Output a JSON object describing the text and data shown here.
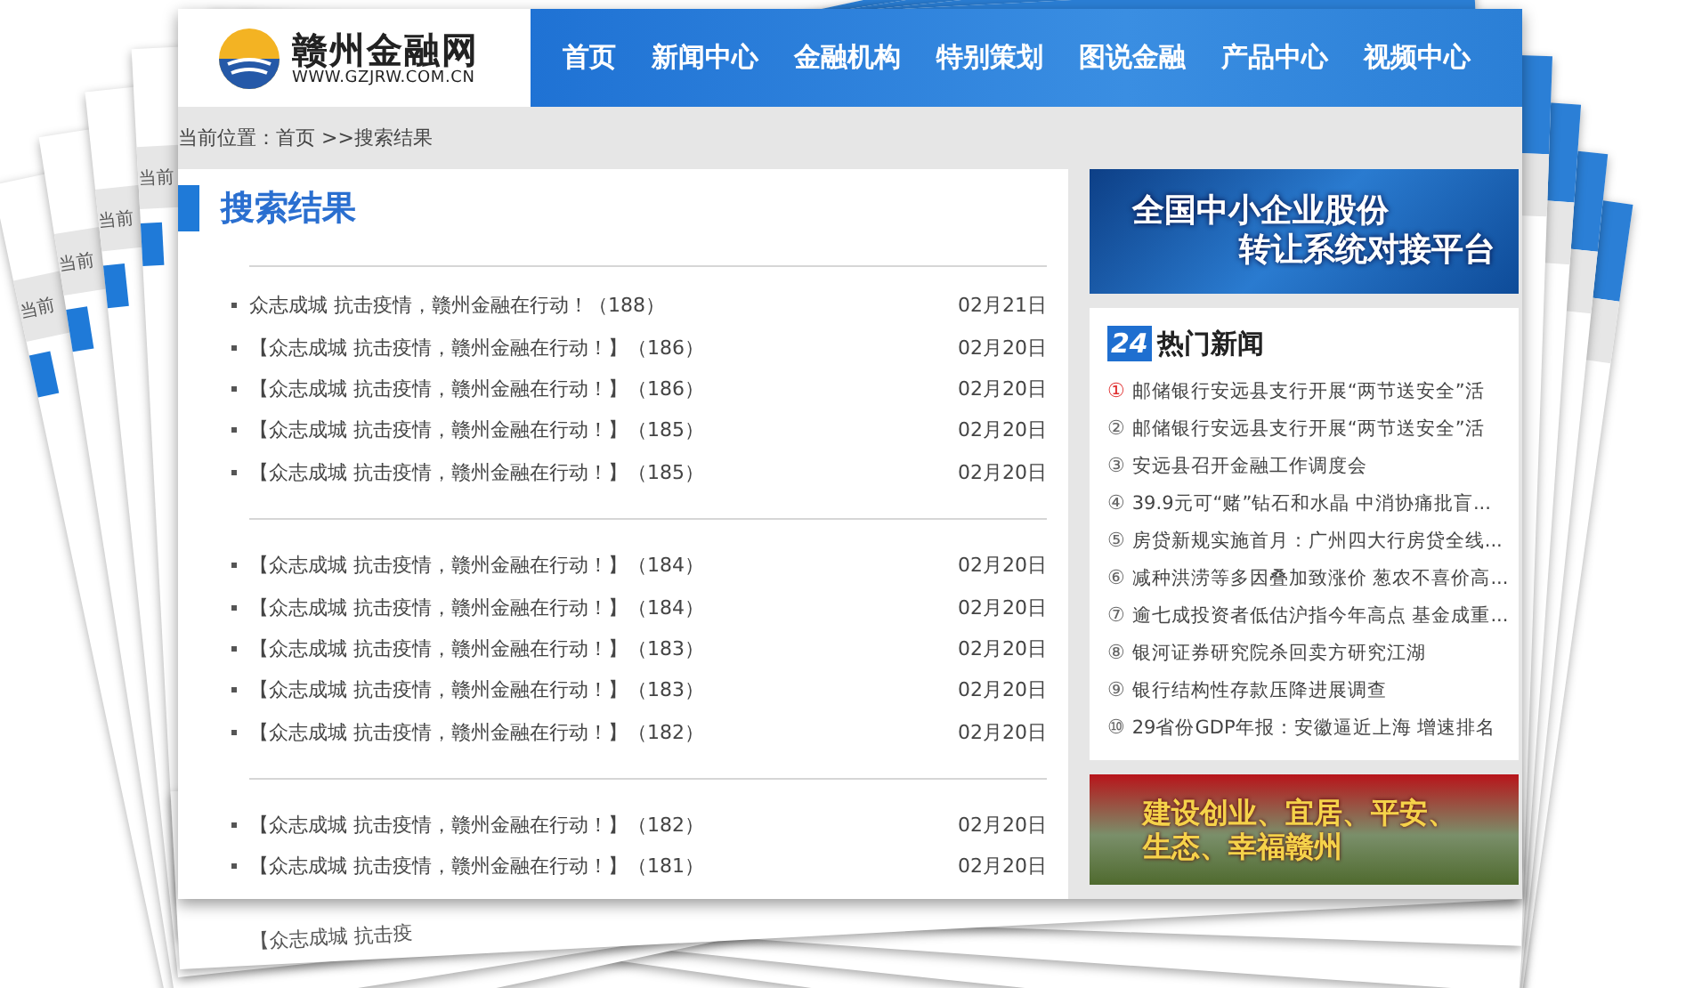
{
  "back_sheets": [
    {
      "crumb": "当前"
    },
    {
      "crumb": "当前"
    },
    {
      "crumb": "当前"
    },
    {
      "crumb": "当前"
    }
  ],
  "bottom_sheet": {
    "list_item": "【众志成城 抗击疫"
  },
  "logo": {
    "name": "赣州金融网",
    "url": "WWW.GZJRW.COM.CN"
  },
  "nav": [
    {
      "label": "首页"
    },
    {
      "label": "新闻中心"
    },
    {
      "label": "金融机构"
    },
    {
      "label": "特别策划"
    },
    {
      "label": "图说金融"
    },
    {
      "label": "产品中心"
    },
    {
      "label": "视频中心"
    }
  ],
  "breadcrumb": "当前位置：首页 >>搜索结果",
  "results": {
    "title": "搜索结果",
    "groups": [
      [
        {
          "title": "众志成城 抗击疫情，赣州金融在行动！（188）",
          "date": "02月21日"
        },
        {
          "title": "【众志成城 抗击疫情，赣州金融在行动！】（186）",
          "date": "02月20日"
        },
        {
          "title": "【众志成城 抗击疫情，赣州金融在行动！】（186）",
          "date": "02月20日"
        },
        {
          "title": "【众志成城 抗击疫情，赣州金融在行动！】（185）",
          "date": "02月20日"
        },
        {
          "title": "【众志成城 抗击疫情，赣州金融在行动！】（185）",
          "date": "02月20日"
        }
      ],
      [
        {
          "title": "【众志成城 抗击疫情，赣州金融在行动！】（184）",
          "date": "02月20日"
        },
        {
          "title": "【众志成城 抗击疫情，赣州金融在行动！】（184）",
          "date": "02月20日"
        },
        {
          "title": "【众志成城 抗击疫情，赣州金融在行动！】（183）",
          "date": "02月20日"
        },
        {
          "title": "【众志成城 抗击疫情，赣州金融在行动！】（183）",
          "date": "02月20日"
        },
        {
          "title": "【众志成城 抗击疫情，赣州金融在行动！】（182）",
          "date": "02月20日"
        }
      ],
      [
        {
          "title": "【众志成城 抗击疫情，赣州金融在行动！】（182）",
          "date": "02月20日"
        },
        {
          "title": "【众志成城 抗击疫情，赣州金融在行动！】（181）",
          "date": "02月20日"
        }
      ]
    ]
  },
  "banner_top": {
    "line_1": "全国中小企业股份",
    "line_2": "转让系统对接平台"
  },
  "hot_news": {
    "badge": "24",
    "title": "热门新闻",
    "items": [
      {
        "num": "①",
        "text": "邮储银行安远县支行开展“两节送安全”活",
        "color": "#e03030"
      },
      {
        "num": "②",
        "text": "邮储银行安远县支行开展“两节送安全”活",
        "color": "#666666"
      },
      {
        "num": "③",
        "text": "安远县召开金融工作调度会",
        "color": "#666666"
      },
      {
        "num": "④",
        "text": "39.9元可“赌”钻石和水晶 中消协痛批盲...",
        "color": "#666666"
      },
      {
        "num": "⑤",
        "text": "房贷新规实施首月：广州四大行房贷全线...",
        "color": "#666666"
      },
      {
        "num": "⑥",
        "text": "减种洪涝等多因叠加致涨价 葱农不喜价高...",
        "color": "#666666"
      },
      {
        "num": "⑦",
        "text": "逾七成投资者低估沪指今年高点 基金成重...",
        "color": "#666666"
      },
      {
        "num": "⑧",
        "text": "银河证券研究院杀回卖方研究江湖",
        "color": "#666666"
      },
      {
        "num": "⑨",
        "text": "银行结构性存款压降进展调查",
        "color": "#666666"
      },
      {
        "num": "⑩",
        "text": "29省份GDP年报：安徽逼近上海 增速排名",
        "color": "#666666"
      }
    ]
  },
  "banner_bottom": {
    "line_1": "建设创业、宜居、平安、",
    "line_2": "生态、幸福赣州"
  }
}
